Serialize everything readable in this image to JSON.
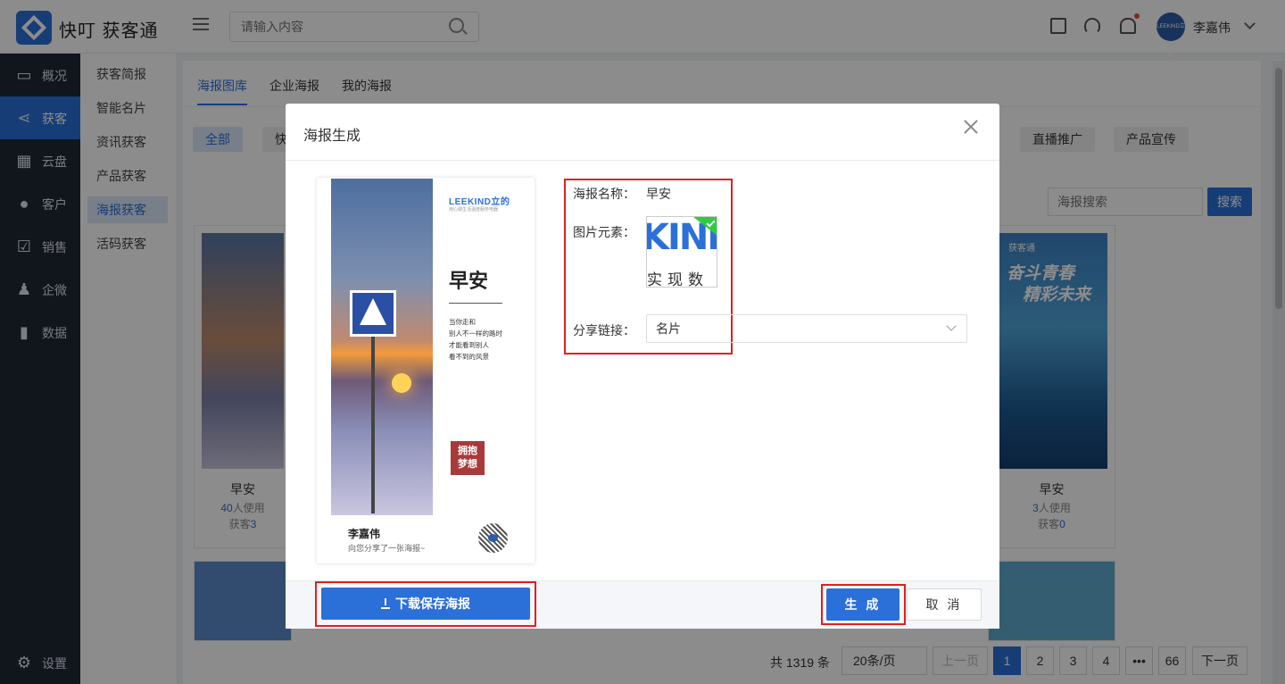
{
  "app": {
    "name": "快叮 获客通"
  },
  "header": {
    "search_placeholder": "请输入内容",
    "user_name": "李嘉伟",
    "avatar_text": "LEEKIND立的"
  },
  "sidebar": {
    "items": [
      {
        "label": "概况",
        "icon": "monitor-icon"
      },
      {
        "label": "获客",
        "icon": "share-icon"
      },
      {
        "label": "云盘",
        "icon": "grid-icon"
      },
      {
        "label": "客户",
        "icon": "user-icon"
      },
      {
        "label": "销售",
        "icon": "checkbox-icon"
      },
      {
        "label": "企微",
        "icon": "person-icon"
      },
      {
        "label": "数据",
        "icon": "bar-chart-icon"
      }
    ],
    "settings_label": "设置"
  },
  "subnav": {
    "items": [
      "获客简报",
      "智能名片",
      "资讯获客",
      "产品获客",
      "海报获客",
      "活码获客"
    ]
  },
  "tabs": [
    "海报图库",
    "企业海报",
    "我的海报"
  ],
  "categories": [
    "全部",
    "快",
    "直播推广",
    "产品宣传"
  ],
  "poster_search": {
    "placeholder": "海报搜索",
    "button": "搜索"
  },
  "cards": [
    {
      "title": "早安",
      "uses_num": "40",
      "uses_suffix": "人使用",
      "gain_prefix": "获客",
      "gain_num": "3"
    },
    {
      "title": "早安",
      "uses_num": "3",
      "uses_suffix": "人使用",
      "gain_prefix": "获客",
      "gain_num": "0"
    }
  ],
  "right_card": {
    "brand": "获客通",
    "title1": "奋斗青春",
    "title2": "精彩未来"
  },
  "pager": {
    "total": "共 1319 条",
    "page_size": "20条/页",
    "prev": "上一页",
    "pages": [
      "1",
      "2",
      "3",
      "4",
      "•••",
      "66"
    ],
    "next": "下一页"
  },
  "modal": {
    "title": "海报生成",
    "preview": {
      "brand": "LEEKIND立的",
      "brand_sub": "用心做生活温度服务电器",
      "title": "早安",
      "poem": "当你走和\n别人不一样的路时\n才能看到别人\n看不到的风景",
      "stamp": "拥抱\n梦想",
      "name": "李嘉伟",
      "share_text": "向您分享了一张海报~"
    },
    "form": {
      "name_label": "海报名称：",
      "name_value": "早安",
      "image_label": "图片元素：",
      "image_logo_text": "KINL",
      "image_sub_text": "实现数",
      "link_label": "分享链接：",
      "link_value": "名片"
    },
    "buttons": {
      "download": "下载保存海报",
      "generate": "生 成",
      "cancel": "取 消"
    }
  },
  "colors": {
    "primary": "#2b6fd9",
    "sidebar": "#1f2836",
    "highlight_red": "#e02020"
  }
}
